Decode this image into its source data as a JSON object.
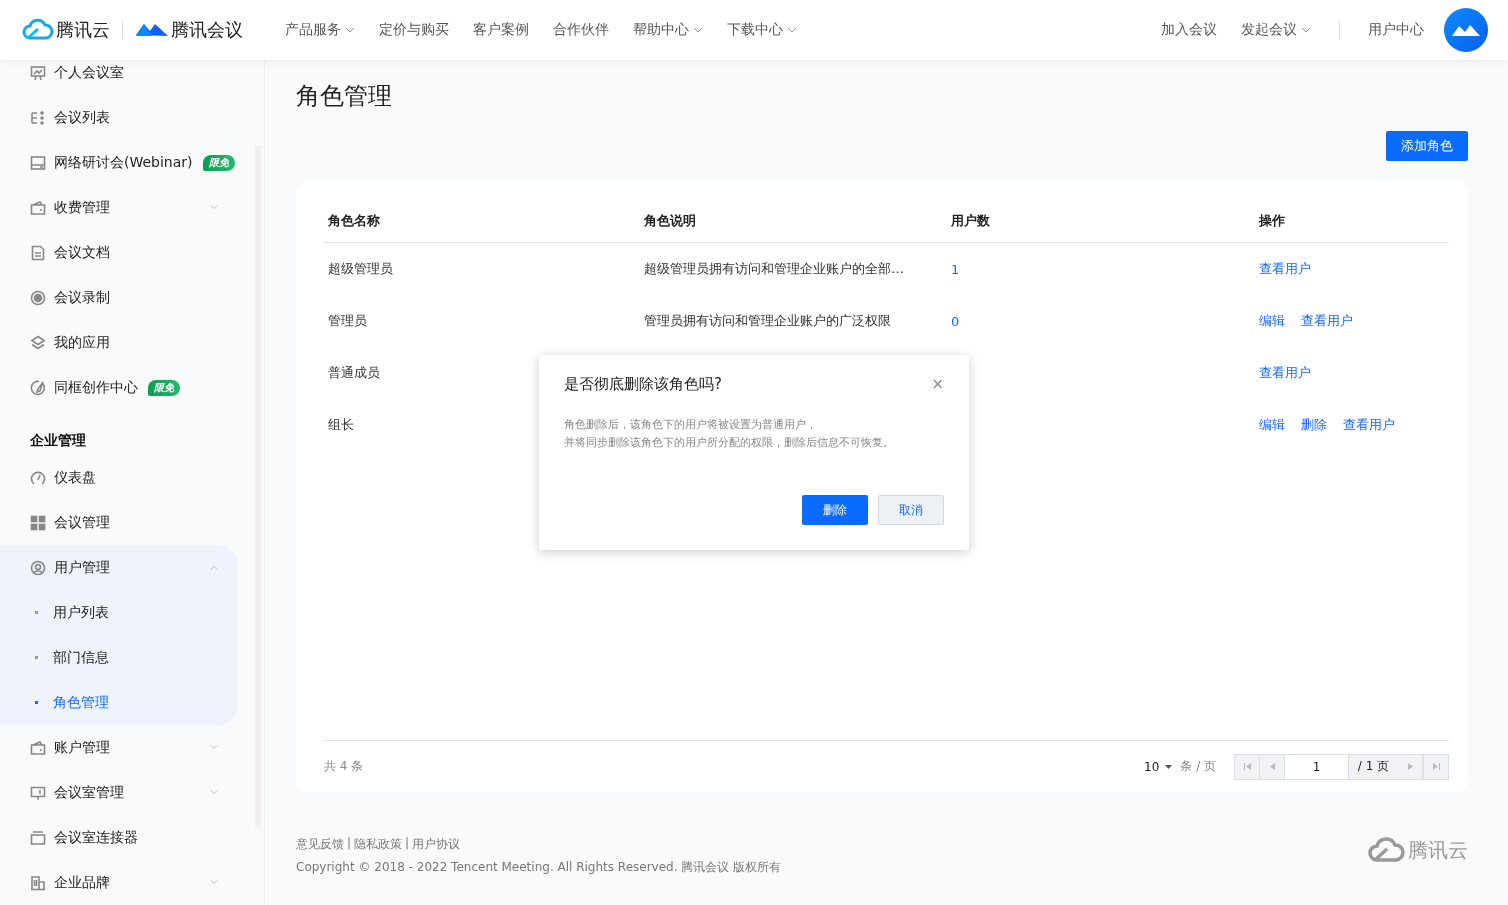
{
  "header": {
    "brand": "腾讯云",
    "product": "腾讯会议",
    "nav": [
      {
        "label": "产品服务",
        "dropdown": true
      },
      {
        "label": "定价与购买",
        "dropdown": false
      },
      {
        "label": "客户案例",
        "dropdown": false
      },
      {
        "label": "合作伙伴",
        "dropdown": false
      },
      {
        "label": "帮助中心",
        "dropdown": true
      },
      {
        "label": "下载中心",
        "dropdown": true
      }
    ],
    "actions": [
      {
        "label": "加入会议",
        "dropdown": false
      },
      {
        "label": "发起会议",
        "dropdown": true
      },
      {
        "label": "用户中心",
        "dropdown": false
      }
    ]
  },
  "sidebar": {
    "groups": [
      {
        "items": [
          {
            "label": "个人会议室",
            "expandable": false,
            "selected": false
          },
          {
            "label": "会议列表",
            "expandable": false,
            "selected": false
          },
          {
            "label": "网络研讨会(Webinar)",
            "badge": "限免",
            "expandable": false,
            "selected": false
          },
          {
            "label": "收费管理",
            "expandable": true,
            "expanded": false,
            "selected": false
          },
          {
            "label": "会议文档",
            "expandable": false,
            "selected": false
          },
          {
            "label": "会议录制",
            "expandable": false,
            "selected": false
          },
          {
            "label": "我的应用",
            "expandable": false,
            "selected": false
          },
          {
            "label": "同框创作中心",
            "badge": "限免",
            "expandable": false,
            "selected": false
          }
        ]
      },
      {
        "title": "企业管理",
        "items": [
          {
            "label": "仪表盘",
            "expandable": false,
            "selected": false
          },
          {
            "label": "会议管理",
            "expandable": false,
            "selected": false
          },
          {
            "label": "用户管理",
            "expandable": true,
            "expanded": true,
            "selected": false,
            "children": [
              {
                "label": "用户列表",
                "selected": false
              },
              {
                "label": "部门信息",
                "selected": false
              },
              {
                "label": "角色管理",
                "selected": true
              }
            ]
          },
          {
            "label": "账户管理",
            "expandable": true,
            "expanded": false,
            "selected": false
          },
          {
            "label": "会议室管理",
            "expandable": true,
            "expanded": false,
            "selected": false
          },
          {
            "label": "会议室连接器",
            "expandable": false,
            "selected": false
          },
          {
            "label": "企业品牌",
            "expandable": true,
            "expanded": false,
            "selected": false
          }
        ]
      }
    ]
  },
  "page": {
    "title": "角色管理",
    "add_button": "添加角色"
  },
  "table": {
    "columns": [
      "角色名称",
      "角色说明",
      "用户数",
      "操作"
    ],
    "rows": [
      {
        "name": "超级管理员",
        "description": "超级管理员拥有访问和管理企业账户的全部…",
        "users": "1",
        "actions": [
          "查看用户"
        ]
      },
      {
        "name": "管理员",
        "description": "管理员拥有访问和管理企业账户的广泛权限",
        "users": "0",
        "actions": [
          "编辑",
          "查看用户"
        ]
      },
      {
        "name": "普通成员",
        "actions": [
          "查看用户"
        ]
      },
      {
        "name": "组长",
        "actions": [
          "编辑",
          "删除",
          "查看用户"
        ]
      }
    ]
  },
  "pagination": {
    "total": "共 4 条",
    "page_size": "10",
    "per_page_label": "条 / 页",
    "page": "1",
    "page_count": "/ 1 页"
  },
  "dialog": {
    "title": "是否彻底删除该角色吗?",
    "close": "×",
    "lines": [
      "角色删除后，该角色下的用户将被设置为普通用户，",
      "并将同步删除该角色下的用户所分配的权限，删除后信息不可恢复。"
    ],
    "confirm": "删除",
    "cancel": "取消"
  },
  "footer": {
    "links": [
      "意见反馈",
      "隐私政策",
      "用户协议"
    ],
    "separator": "|",
    "copyright": "Copyright © 2018 - 2022 Tencent Meeting. All Rights Reserved. 腾讯会议 版权所有",
    "brand": "腾讯云"
  }
}
